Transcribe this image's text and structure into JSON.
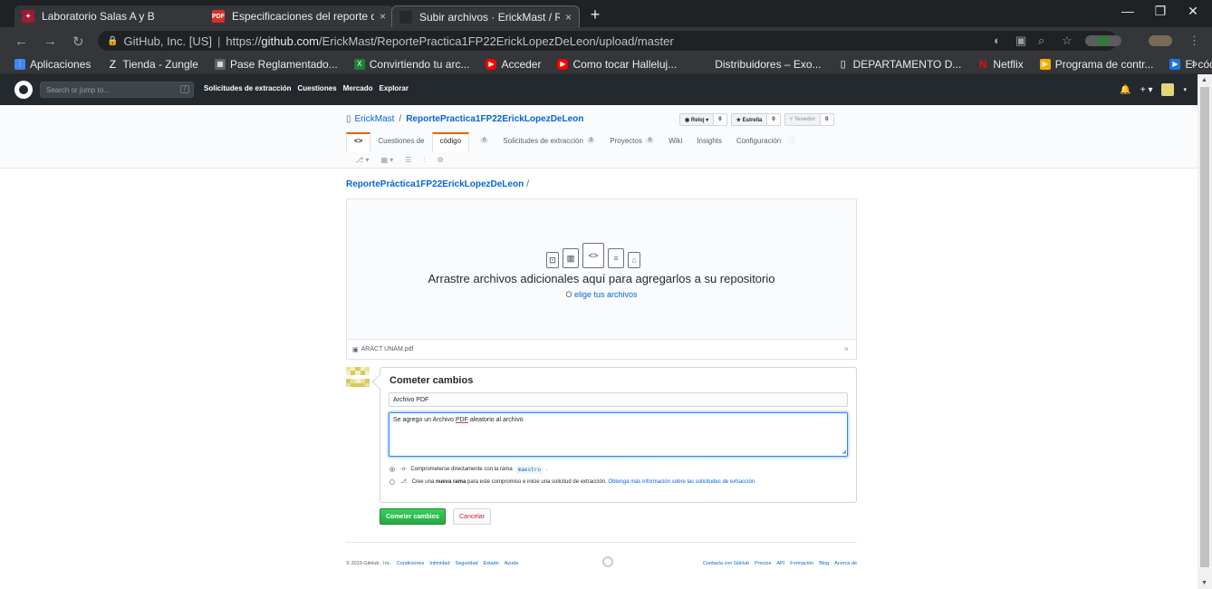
{
  "browser": {
    "tabs": [
      {
        "title": "Laboratorio Salas A y B",
        "close": "×"
      },
      {
        "title": "Especificaciones del reporte de la",
        "close": "×"
      },
      {
        "title": "Subir archivos · ErickMast / Repo",
        "close": "×"
      }
    ],
    "new_tab": "+",
    "window_controls": {
      "minimize": "—",
      "restore": "❐",
      "close": "✕"
    },
    "url_host": "GitHub, Inc. [US]",
    "url_separator": "|",
    "url_prefix": "https://",
    "url_domain": "github.com",
    "url_path": "/ErickMast/ReportePractica1FP22ErickLopezDeLeon/upload/master",
    "bookmarks": [
      "Aplicaciones",
      "Tienda - Zungle",
      "Pase Reglamentado...",
      "Convirtiendo tu arc...",
      "Acceder",
      "Como tocar Halleluj...",
      "Distribuidores – Exo...",
      "DEPARTAMENTO D...",
      "Netflix",
      "Programa de contr...",
      "El código ASCII Co..."
    ],
    "bookmarks_more": "»"
  },
  "github": {
    "search_placeholder": "Search or jump to...",
    "search_key": "/",
    "nav": [
      "Solicitudes de extracción",
      "Cuestiones",
      "Mercado",
      "Explorar"
    ],
    "header_right": [
      "🔔",
      "+ ▾"
    ]
  },
  "repo": {
    "owner": "ErickMast",
    "separator": "/",
    "name": "ReportePractica1FP22ErickLopezDeLeon",
    "watch": {
      "label": "◉ Reloj ▾",
      "count": "0"
    },
    "star": {
      "label": "★ Estrella",
      "count": "0"
    },
    "fork": {
      "label": "⑂ Tenedor",
      "count": "0"
    },
    "tabs": [
      {
        "label": "<>",
        "counter": ""
      },
      {
        "label": "Cuestiones de",
        "counter": ""
      },
      {
        "label": "código",
        "counter": "0"
      },
      {
        "label": "Solicitudes de extracción",
        "counter": "0"
      },
      {
        "label": "Proyectos",
        "counter": "0"
      },
      {
        "label": "Wiki",
        "counter": ""
      },
      {
        "label": "Insights",
        "counter": ""
      },
      {
        "label": "Configuración",
        "counter": ""
      }
    ],
    "tabs_row2": [
      "⎇ ▾",
      "▦ ▾",
      "☰",
      "⫶",
      "⚙"
    ]
  },
  "upload": {
    "breadcrumb": "ReportePráctica1FP22ErickLopezDeLeon",
    "breadcrumb_slash": "/",
    "drop_title": "Arrastre archivos adicionales aquí para agregarlos a su repositorio",
    "drop_sub_prefix": "O",
    "drop_sub_link": "elige tus archivos",
    "file_name": "ARACT UNAM.pdf",
    "file_remove": "×"
  },
  "commit": {
    "title": "Cometer cambios",
    "summary_value": "Archivo PDF",
    "description_part1": "Se agrego un Archivo ",
    "description_underlined": "PDF",
    "description_part2": " aleatorio al archivo",
    "option1_text": "Comprometerse directamente con la rama",
    "option1_branch": "maestro",
    "option1_end": ".",
    "option2_prefix": "Cree una",
    "option2_bold": "nueva rama",
    "option2_text": "para este compromiso e inicie una solicitud de extracción.",
    "option2_link": "Obtenga más información sobre las solicitudes de extracción.",
    "submit_label": "Cometer cambios",
    "cancel_label": "Cancelar"
  },
  "footer": {
    "copyright": "© 2019 GitHub , Inc.",
    "left_links": [
      "Condiciones",
      "Intimidad",
      "Seguridad",
      "Estado",
      "Ayuda"
    ],
    "right_links": [
      "Contacta con GitHub",
      "Precios",
      "API",
      "Formación",
      "Blog",
      "Acerca de"
    ]
  },
  "colors": {
    "chrome_dark": "#202124",
    "github_header": "#24292e",
    "link_blue": "#0366d6",
    "commit_green": "#28a745",
    "cancel_red": "#cb2431",
    "tab_accent": "#e36209"
  }
}
